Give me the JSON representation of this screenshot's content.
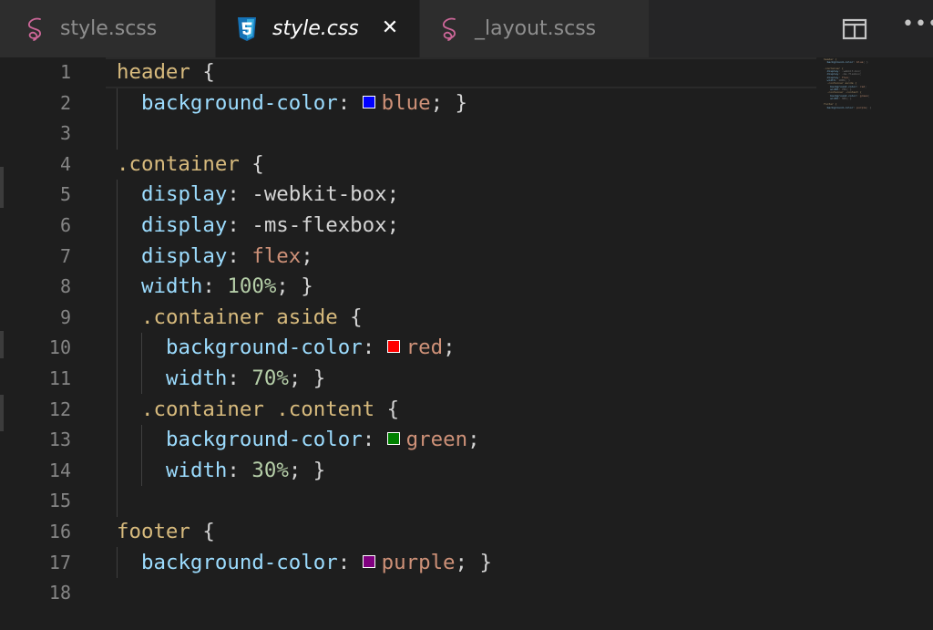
{
  "tabs": [
    {
      "label": "style.scss",
      "icon": "sass-icon",
      "active": false
    },
    {
      "label": "style.css",
      "icon": "css3-icon",
      "active": true
    },
    {
      "label": "_layout.scss",
      "icon": "sass-icon",
      "active": false
    }
  ],
  "actions": {
    "split_icon": "split-editor-icon",
    "more_label": "•••"
  },
  "colors": {
    "sass": "#cd6799",
    "css3": "#1572b6",
    "selector": "#d7ba7d",
    "property": "#9cdcfe",
    "value": "#ce9178",
    "number": "#b5cea8",
    "swatch_blue": "#0000ff",
    "swatch_red": "#ff0000",
    "swatch_green": "#008000",
    "swatch_purple": "#800080"
  },
  "lines": [
    {
      "n": "1",
      "t": [
        [
          "sel",
          "header"
        ],
        [
          "punc",
          " {"
        ]
      ]
    },
    {
      "n": "2",
      "t": [
        [
          "prop",
          "background-color"
        ],
        [
          "punc",
          ": "
        ],
        [
          "swatch",
          "blue"
        ],
        [
          "val",
          "blue"
        ],
        [
          "punc",
          "; }"
        ]
      ]
    },
    {
      "n": "3",
      "t": []
    },
    {
      "n": "4",
      "t": [
        [
          "sel",
          ".container"
        ],
        [
          "punc",
          " {"
        ]
      ]
    },
    {
      "n": "5",
      "t": [
        [
          "prop",
          "display"
        ],
        [
          "punc",
          ": "
        ],
        [
          "punc",
          "-webkit-box"
        ],
        [
          "punc",
          ";"
        ]
      ]
    },
    {
      "n": "6",
      "t": [
        [
          "prop",
          "display"
        ],
        [
          "punc",
          ": "
        ],
        [
          "punc",
          "-ms-flexbox"
        ],
        [
          "punc",
          ";"
        ]
      ]
    },
    {
      "n": "7",
      "t": [
        [
          "prop",
          "display"
        ],
        [
          "punc",
          ": "
        ],
        [
          "val",
          "flex"
        ],
        [
          "punc",
          ";"
        ]
      ]
    },
    {
      "n": "8",
      "t": [
        [
          "prop",
          "width"
        ],
        [
          "punc",
          ": "
        ],
        [
          "num",
          "100%"
        ],
        [
          "punc",
          "; }"
        ]
      ]
    },
    {
      "n": "9",
      "t": [
        [
          "sel",
          ".container aside"
        ],
        [
          "punc",
          " {"
        ]
      ]
    },
    {
      "n": "10",
      "t": [
        [
          "prop",
          "background-color"
        ],
        [
          "punc",
          ": "
        ],
        [
          "swatch",
          "red"
        ],
        [
          "val",
          "red"
        ],
        [
          "punc",
          ";"
        ]
      ]
    },
    {
      "n": "11",
      "t": [
        [
          "prop",
          "width"
        ],
        [
          "punc",
          ": "
        ],
        [
          "num",
          "70%"
        ],
        [
          "punc",
          "; }"
        ]
      ]
    },
    {
      "n": "12",
      "t": [
        [
          "sel",
          ".container .content"
        ],
        [
          "punc",
          " {"
        ]
      ]
    },
    {
      "n": "13",
      "t": [
        [
          "prop",
          "background-color"
        ],
        [
          "punc",
          ": "
        ],
        [
          "swatch",
          "green"
        ],
        [
          "val",
          "green"
        ],
        [
          "punc",
          ";"
        ]
      ]
    },
    {
      "n": "14",
      "t": [
        [
          "prop",
          "width"
        ],
        [
          "punc",
          ": "
        ],
        [
          "num",
          "30%"
        ],
        [
          "punc",
          "; }"
        ]
      ]
    },
    {
      "n": "15",
      "t": []
    },
    {
      "n": "16",
      "t": [
        [
          "sel",
          "footer"
        ],
        [
          "punc",
          " {"
        ]
      ]
    },
    {
      "n": "17",
      "t": [
        [
          "prop",
          "background-color"
        ],
        [
          "punc",
          ": "
        ],
        [
          "swatch",
          "purple"
        ],
        [
          "val",
          "purple"
        ],
        [
          "punc",
          "; }"
        ]
      ]
    },
    {
      "n": "18",
      "t": []
    }
  ]
}
